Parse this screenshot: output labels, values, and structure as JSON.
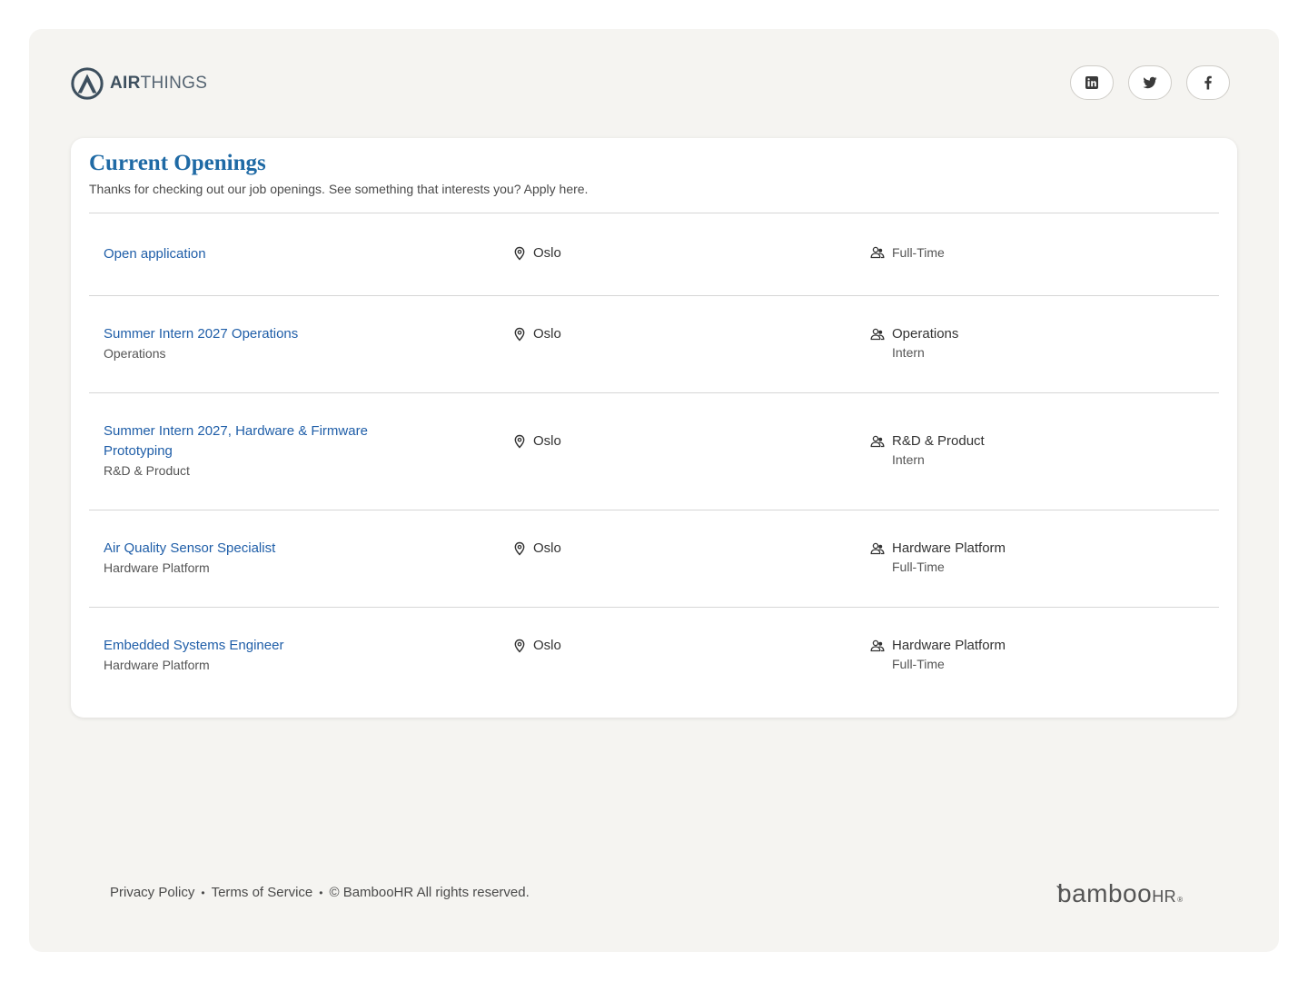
{
  "brand": {
    "name_bold": "AIR",
    "name_light": "THINGS",
    "icon": "airthings-logo-icon"
  },
  "social": [
    {
      "name": "LinkedIn",
      "icon": "linkedin-icon"
    },
    {
      "name": "Twitter",
      "icon": "twitter-icon"
    },
    {
      "name": "Facebook",
      "icon": "facebook-icon"
    }
  ],
  "openings": {
    "title": "Current Openings",
    "subtitle": "Thanks for checking out our job openings. See something that interests you? Apply here.",
    "jobs": [
      {
        "title": "Open application",
        "department": "",
        "location": "Oslo",
        "type_main": "",
        "type_sub": "Full-Time"
      },
      {
        "title": "Summer Intern 2027 Operations",
        "department": "Operations",
        "location": "Oslo",
        "type_main": "Operations",
        "type_sub": "Intern"
      },
      {
        "title": "Summer Intern 2027, Hardware & Firmware Prototyping",
        "department": "R&D & Product",
        "location": "Oslo",
        "type_main": "R&D & Product",
        "type_sub": "Intern"
      },
      {
        "title": "Air Quality Sensor Specialist",
        "department": "Hardware Platform",
        "location": "Oslo",
        "type_main": "Hardware Platform",
        "type_sub": "Full-Time"
      },
      {
        "title": "Embedded Systems Engineer",
        "department": "Hardware Platform",
        "location": "Oslo",
        "type_main": "Hardware Platform",
        "type_sub": "Full-Time"
      }
    ]
  },
  "footer": {
    "privacy": "Privacy Policy",
    "terms": "Terms of Service",
    "copyright": "© BambooHR All rights reserved.",
    "separator": "•",
    "powered_by_main": "bamboo",
    "powered_by_hr": "HR",
    "powered_by_reg": "®"
  },
  "colors": {
    "accent": "#1f6aa5",
    "link": "#1f5ea8",
    "background": "#f5f4f1"
  }
}
